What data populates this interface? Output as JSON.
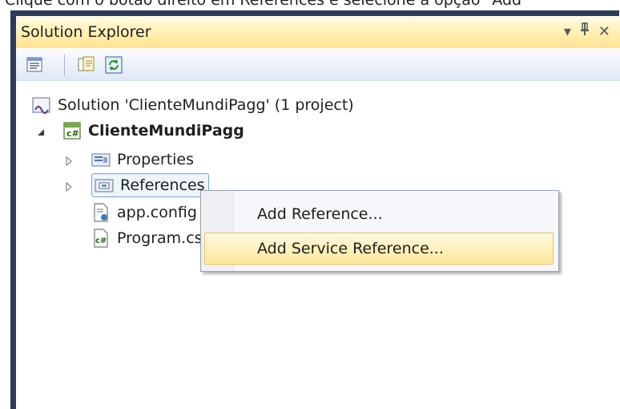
{
  "caption": "Clique com o botão direito em References e selecione a opção \"Add",
  "panel": {
    "title": "Solution Explorer",
    "controls": {
      "dropdown_glyph": "▾",
      "pin_glyph": "⊣",
      "close_glyph": "✕"
    }
  },
  "toolbar": {
    "buttons": [
      {
        "name": "properties-icon"
      },
      {
        "name": "show-all-files-icon"
      },
      {
        "name": "refresh-icon"
      }
    ]
  },
  "tree": {
    "solution_label": "Solution 'ClienteMundiPagg' (1 project)",
    "project_label": "ClienteMundiPagg",
    "properties_label": "Properties",
    "references_label": "References",
    "appconfig_label": "app.config",
    "program_label": "Program.cs"
  },
  "context_menu": {
    "items": [
      {
        "label": "Add Reference..."
      },
      {
        "label": "Add Service Reference..."
      }
    ]
  },
  "colors": {
    "frame": "#2b3c59",
    "title_gradient_start": "#fffbe6",
    "title_gradient_end": "#ffe38f",
    "menu_hover": "#ffe89b",
    "selection_border": "#7da2ce"
  }
}
